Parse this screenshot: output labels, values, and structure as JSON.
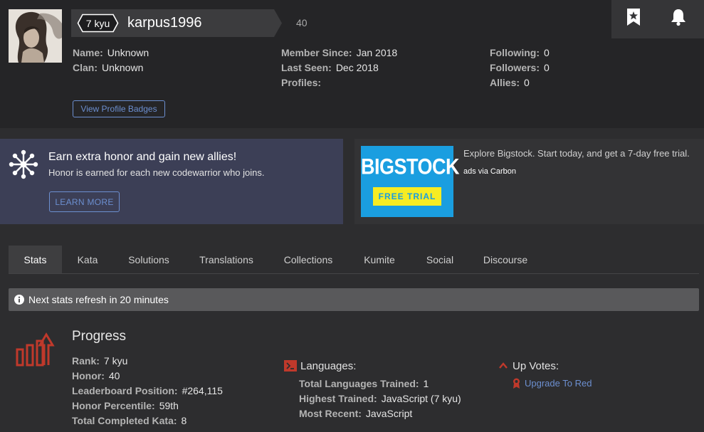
{
  "profile": {
    "rank": "7 kyu",
    "username": "karpus1996",
    "honor": "40",
    "avatar_alt": "user-avatar",
    "info_left": [
      {
        "label": "Name:",
        "value": "Unknown"
      },
      {
        "label": "Clan:",
        "value": "Unknown"
      }
    ],
    "info_middle": [
      {
        "label": "Member Since:",
        "value": "Jan 2018"
      },
      {
        "label": "Last Seen:",
        "value": "Dec 2018"
      },
      {
        "label": "Profiles:",
        "value": ""
      }
    ],
    "info_right": [
      {
        "label": "Following:",
        "value": "0"
      },
      {
        "label": "Followers:",
        "value": "0"
      },
      {
        "label": "Allies:",
        "value": "0"
      }
    ],
    "badges_button": "View Profile Badges"
  },
  "top_icons": [
    "bookmark-star-icon",
    "bell-icon"
  ],
  "referral": {
    "title": "Earn extra honor and gain new allies!",
    "subtitle": "Honor is earned for each new codewarrior who joins.",
    "button": "LEARN MORE"
  },
  "ad": {
    "brand": "BIGSTOCK",
    "cta": "FREE TRIAL",
    "text": "Explore Bigstock. Start today, and get a 7-day free trial.",
    "via": "ads via Carbon"
  },
  "tabs": [
    "Stats",
    "Kata",
    "Solutions",
    "Translations",
    "Collections",
    "Kumite",
    "Social",
    "Discourse"
  ],
  "active_tab": "Stats",
  "notice": "Next stats refresh in 20 minutes",
  "progress": {
    "title": "Progress",
    "stats": [
      {
        "label": "Rank:",
        "value": "7 kyu"
      },
      {
        "label": "Honor:",
        "value": "40"
      },
      {
        "label": "Leaderboard Position:",
        "value": "#264,115"
      },
      {
        "label": "Honor Percentile:",
        "value": "59th"
      },
      {
        "label": "Total Completed Kata:",
        "value": "8"
      }
    ]
  },
  "languages": {
    "title": "Languages:",
    "stats": [
      {
        "label": "Total Languages Trained:",
        "value": "1"
      },
      {
        "label": "Highest Trained:",
        "value": "JavaScript (7 kyu)"
      },
      {
        "label": "Most Recent:",
        "value": "JavaScript"
      }
    ]
  },
  "upvotes": {
    "title": "Up Votes:",
    "link": "Upgrade To Red"
  },
  "colors": {
    "accent_blue": "#6c8fd0",
    "red": "#c0392b",
    "ad_blue": "#1a9ee0",
    "ad_yellow": "#f6ec23"
  }
}
